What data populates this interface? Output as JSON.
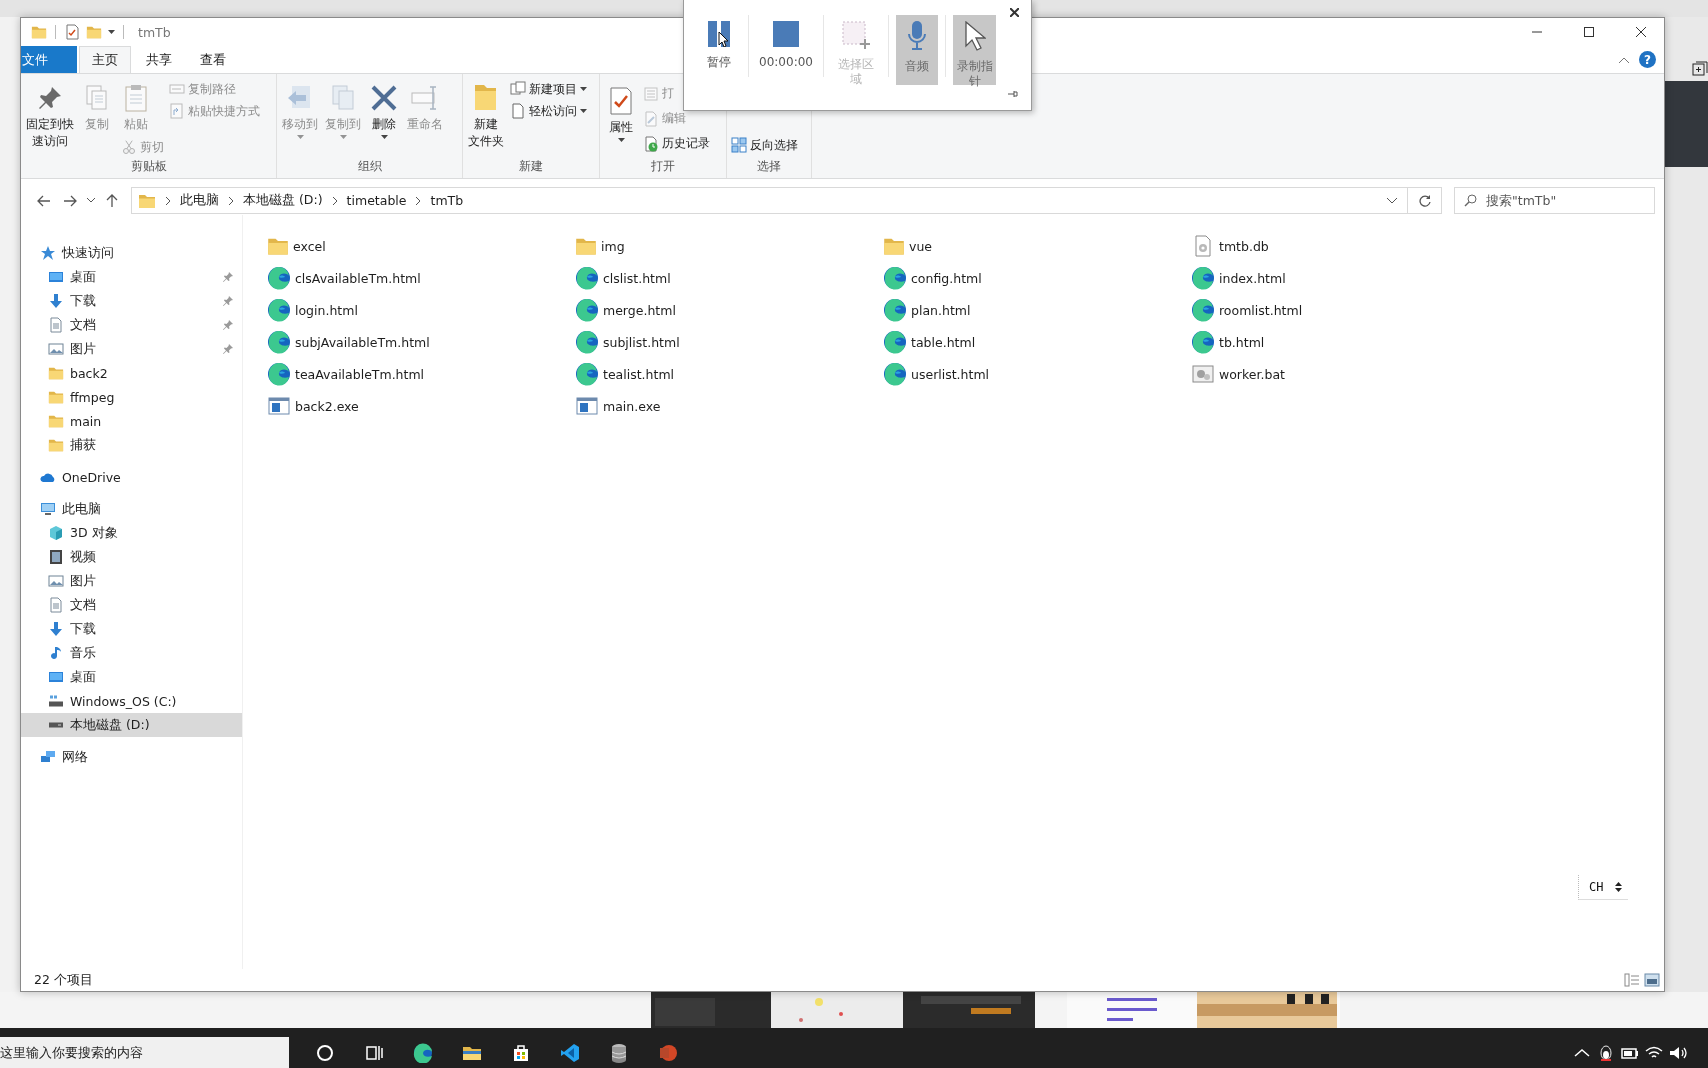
{
  "window": {
    "title": "tmTb",
    "help": "?"
  },
  "ribbon_tabs": [
    {
      "label": "文件",
      "kind": "file",
      "selected": false
    },
    {
      "label": "主页",
      "kind": "tab",
      "selected": true
    },
    {
      "label": "共享",
      "kind": "tab",
      "selected": false
    },
    {
      "label": "查看",
      "kind": "tab",
      "selected": false
    }
  ],
  "ribbon_groups": [
    {
      "label": "剪贴板",
      "columns": [
        [
          {
            "lines": [
              "固定到快",
              "速访问"
            ],
            "kind": "large",
            "disabled": false,
            "dropdown": false
          }
        ],
        [
          {
            "label": "复制",
            "kind": "large",
            "disabled": true,
            "dropdown": false
          }
        ],
        [
          {
            "label": "粘贴",
            "kind": "large",
            "disabled": true,
            "dropdown": false
          },
          {
            "label": "剪切",
            "kind": "small",
            "disabled": true,
            "dropdown": false
          }
        ],
        [
          {
            "label": "复制路径",
            "kind": "small",
            "disabled": true,
            "dropdown": false
          },
          {
            "label": "粘贴快捷方式",
            "kind": "small",
            "disabled": true,
            "dropdown": false
          }
        ]
      ]
    },
    {
      "label": "组织",
      "columns": [
        [
          {
            "label": "移动到",
            "kind": "large",
            "disabled": true,
            "dropdown": true
          }
        ],
        [
          {
            "label": "复制到",
            "kind": "large",
            "disabled": true,
            "dropdown": true
          }
        ],
        [
          {
            "label": "删除",
            "kind": "large",
            "disabled": false,
            "dropdown": true
          }
        ],
        [
          {
            "label": "重命名",
            "kind": "large",
            "disabled": true,
            "dropdown": false
          }
        ]
      ]
    },
    {
      "label": "新建",
      "columns": [
        [
          {
            "lines": [
              "新建",
              "文件夹"
            ],
            "kind": "large",
            "disabled": false,
            "dropdown": false
          }
        ],
        [
          {
            "label": "新建项目",
            "kind": "small",
            "disabled": false,
            "dropdown": true
          },
          {
            "label": "轻松访问",
            "kind": "small",
            "disabled": false,
            "dropdown": true
          }
        ]
      ]
    },
    {
      "label": "打开",
      "columns": [
        [
          {
            "label": "属性",
            "kind": "large",
            "disabled": false,
            "dropdown": true
          }
        ],
        [
          {
            "label": "打",
            "kind": "small",
            "disabled": true,
            "dropdown": false
          },
          {
            "label": "编辑",
            "kind": "small",
            "disabled": true,
            "dropdown": false
          },
          {
            "label": "历史记录",
            "kind": "small",
            "disabled": false,
            "dropdown": false
          }
        ]
      ]
    },
    {
      "label": "选择",
      "columns": [
        [
          {
            "label": "反向选择",
            "kind": "small",
            "disabled": false,
            "dropdown": false
          }
        ]
      ]
    }
  ],
  "address": {
    "crumbs": [
      "此电脑",
      "本地磁盘 (D:)",
      "timetable",
      "tmTb"
    ],
    "search_placeholder": "搜索\"tmTb\""
  },
  "nav": [
    {
      "label": "快速访问",
      "kind": "star",
      "selected": false,
      "children": [
        {
          "label": "桌面",
          "kind": "desktop",
          "pinned": true,
          "selected": false
        },
        {
          "label": "下载",
          "kind": "download",
          "pinned": true,
          "selected": false
        },
        {
          "label": "文档",
          "kind": "document",
          "pinned": true,
          "selected": false
        },
        {
          "label": "图片",
          "kind": "picture",
          "pinned": true,
          "selected": false
        },
        {
          "label": "back2",
          "kind": "folder",
          "pinned": false,
          "selected": false
        },
        {
          "label": "ffmpeg",
          "kind": "folder",
          "pinned": false,
          "selected": false
        },
        {
          "label": "main",
          "kind": "folder",
          "pinned": false,
          "selected": false
        },
        {
          "label": "捕获",
          "kind": "folder",
          "pinned": false,
          "selected": false
        }
      ]
    },
    {
      "label": "OneDrive",
      "kind": "cloud",
      "selected": false
    },
    {
      "label": "此电脑",
      "kind": "pc",
      "selected": false,
      "children": [
        {
          "label": "3D 对象",
          "kind": "cube",
          "selected": false
        },
        {
          "label": "视频",
          "kind": "video",
          "selected": false
        },
        {
          "label": "图片",
          "kind": "picture",
          "selected": false
        },
        {
          "label": "文档",
          "kind": "document",
          "selected": false
        },
        {
          "label": "下载",
          "kind": "download",
          "selected": false
        },
        {
          "label": "音乐",
          "kind": "music",
          "selected": false
        },
        {
          "label": "桌面",
          "kind": "desktop",
          "selected": false
        },
        {
          "label": "Windows_OS (C:)",
          "kind": "systemdrive",
          "selected": false
        },
        {
          "label": "本地磁盘 (D:)",
          "kind": "drive",
          "selected": true
        }
      ]
    },
    {
      "label": "网络",
      "kind": "network",
      "selected": false
    }
  ],
  "files": [
    {
      "name": "excel",
      "kind": "folder"
    },
    {
      "name": "img",
      "kind": "folder"
    },
    {
      "name": "vue",
      "kind": "folder"
    },
    {
      "name": "tmtb.db",
      "kind": "data"
    },
    {
      "name": "clsAvailableTm.html",
      "kind": "html"
    },
    {
      "name": "clslist.html",
      "kind": "html"
    },
    {
      "name": "config.html",
      "kind": "html"
    },
    {
      "name": "index.html",
      "kind": "html"
    },
    {
      "name": "login.html",
      "kind": "html"
    },
    {
      "name": "merge.html",
      "kind": "html"
    },
    {
      "name": "plan.html",
      "kind": "html"
    },
    {
      "name": "roomlist.html",
      "kind": "html"
    },
    {
      "name": "subjAvailableTm.html",
      "kind": "html"
    },
    {
      "name": "subjlist.html",
      "kind": "html"
    },
    {
      "name": "table.html",
      "kind": "html"
    },
    {
      "name": "tb.html",
      "kind": "html"
    },
    {
      "name": "teaAvailableTm.html",
      "kind": "html"
    },
    {
      "name": "tealist.html",
      "kind": "html"
    },
    {
      "name": "userlist.html",
      "kind": "html"
    },
    {
      "name": "worker.bat",
      "kind": "batch"
    },
    {
      "name": "back2.exe",
      "kind": "exe"
    },
    {
      "name": "main.exe",
      "kind": "exe"
    }
  ],
  "status_bar": {
    "text": "22 个项目"
  },
  "ime_indicator": {
    "label": "CH"
  },
  "recorder": {
    "buttons": [
      {
        "label": "暂停",
        "kind": "pause",
        "on": false,
        "disabled": false
      },
      {
        "label": "00:00:00",
        "kind": "stop",
        "on": false,
        "disabled": false
      },
      {
        "lines": [
          "选择区",
          "域"
        ],
        "kind": "region",
        "on": false,
        "disabled": true
      },
      {
        "label": "音频",
        "kind": "mic",
        "on": true,
        "disabled": false
      },
      {
        "lines": [
          "录制指",
          "针"
        ],
        "kind": "pointer",
        "on": true,
        "disabled": false
      }
    ]
  },
  "taskbar": {
    "placeholder": "这里输入你要搜索的内容"
  }
}
